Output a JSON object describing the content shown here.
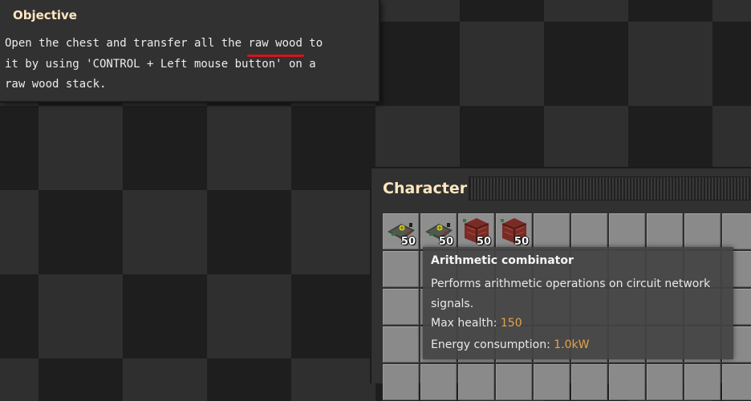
{
  "objective": {
    "title": "Objective",
    "text_before": "Open the chest and transfer all the ",
    "highlight": "raw wood",
    "text_after": " to\nit by using 'CONTROL + Left mouse button' on a\nraw wood stack.",
    "highlight_color": "#d3151c"
  },
  "character": {
    "title": "Character",
    "slots": [
      {
        "item": "arithmetic-combinator-icon",
        "count": "50"
      },
      {
        "item": "arithmetic-combinator-icon",
        "count": "50"
      },
      {
        "item": "wooden-chest-icon",
        "count": "50"
      },
      {
        "item": "wooden-chest-icon",
        "count": "50"
      }
    ]
  },
  "tooltip": {
    "name": "Arithmetic combinator",
    "description": "Performs arithmetic operations on circuit network signals.",
    "health_label": "Max health: ",
    "health_value": "150",
    "energy_label": "Energy consumption: ",
    "energy_value": "1.0kW",
    "value_color": "#e7a24a"
  }
}
